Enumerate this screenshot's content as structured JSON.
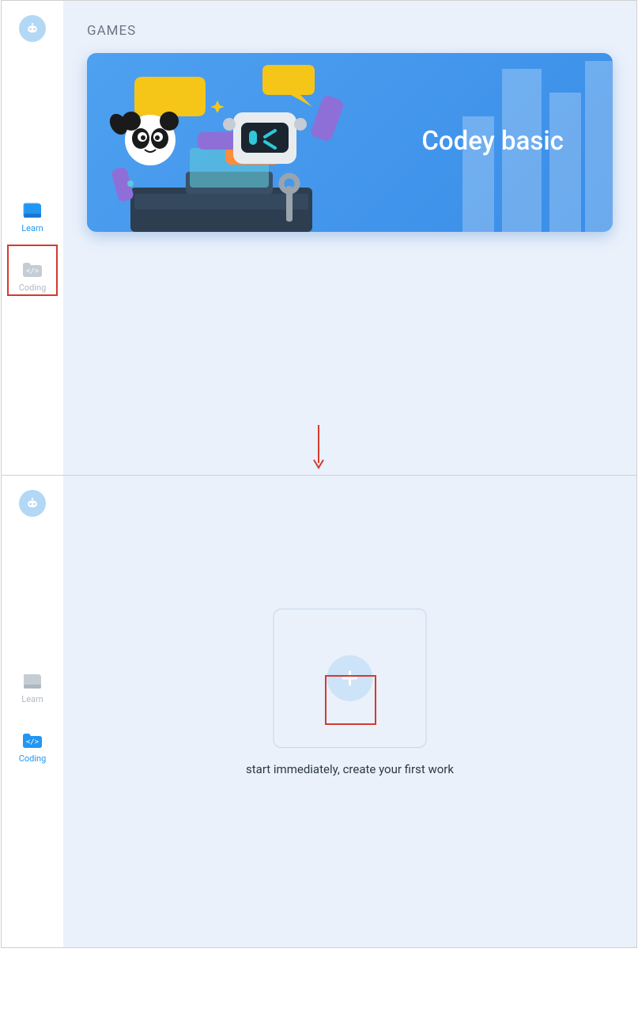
{
  "sidebar": {
    "items": [
      {
        "label": "Learn"
      },
      {
        "label": "Coding"
      }
    ]
  },
  "screen1": {
    "section_title": "GAMES",
    "game_card": {
      "title": "Codey basic"
    }
  },
  "screen2": {
    "empty_text": "start immediately, create your first work"
  }
}
